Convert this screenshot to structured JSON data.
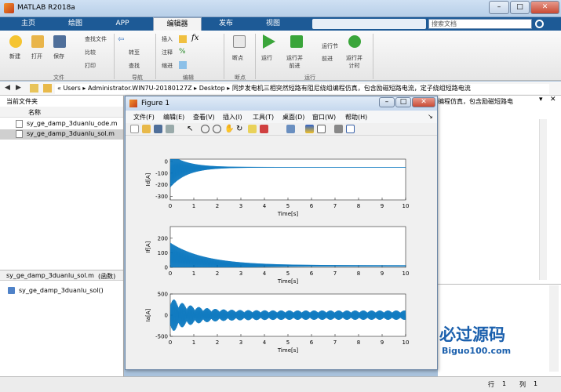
{
  "window": {
    "title": "MATLAB R2018a",
    "search_placeholder": "搜索文档"
  },
  "tabs": [
    "主页",
    "绘图",
    "APP",
    "编辑器",
    "发布",
    "视图"
  ],
  "ribbon": {
    "file": {
      "new": "新建",
      "open": "打开",
      "save": "保存",
      "find_files": "查找文件",
      "compare": "比较",
      "print": "打印",
      "group": "文件"
    },
    "navigate": {
      "goto": "转至",
      "find": "查找",
      "group": "导航"
    },
    "edit": {
      "insert": "插入",
      "comment": "注释",
      "indent": "缩进",
      "fx": "fx",
      "group": "编辑"
    },
    "breakpoints": {
      "label": "断点",
      "group": "断点"
    },
    "run": {
      "run": "运行",
      "run_advance": "运行并\n前进",
      "run_section": "运行节",
      "advance": "前进",
      "run_time": "运行并\n计时",
      "group": "运行"
    }
  },
  "address": {
    "path": [
      "Users",
      "Administrator.WIN7U-20180127Z",
      "Desktop",
      "同步发电机三相突然短路有阻尼绕组编程仿真，包含励磁短路电流，定子绕组短路电流"
    ]
  },
  "left_panel": {
    "title": "当前文件夹",
    "col_name": "名称",
    "files": [
      "sy_ge_damp_3duanlu_ode.m",
      "sy_ge_damp_3duanlu_sol.m"
    ],
    "detail_title": "sy_ge_damp_3duanlu_sol.m",
    "detail_type": "(函数)",
    "detail_item": "sy_ge_damp_3duanlu_sol()"
  },
  "right_panel": {
    "path_tail": "编程仿真，包含励磁短路电"
  },
  "status": {
    "row_label": "行",
    "row": "1",
    "col_label": "列",
    "col": "1"
  },
  "watermark": {
    "cn": "必过源码",
    "en": "Biguo100.com"
  },
  "figure": {
    "title": "Figure 1",
    "menu": [
      "文件(F)",
      "编辑(E)",
      "查看(V)",
      "插入(I)",
      "工具(T)",
      "桌面(D)",
      "窗口(W)",
      "帮助(H)"
    ]
  },
  "chart_data": [
    {
      "type": "line",
      "ylabel": "Id[A]",
      "xlabel": "Time[s]",
      "xlim": [
        0,
        10
      ],
      "ylim": [
        -300,
        0
      ],
      "x_ticks": [
        "0",
        "1",
        "2",
        "3",
        "4",
        "5",
        "6",
        "7",
        "8",
        "9",
        "10"
      ],
      "y_ticks": [
        "0",
        "-100",
        "-200",
        "-300"
      ],
      "series": [
        {
          "values_desc": "decaying oscillation",
          "steady": -50,
          "initial_min": -330,
          "initial_max": 10
        }
      ],
      "color": "#0072bd"
    },
    {
      "type": "line",
      "ylabel": "If[A]",
      "xlabel": "Time[s]",
      "xlim": [
        0,
        10
      ],
      "ylim": [
        0,
        200
      ],
      "x_ticks": [
        "0",
        "1",
        "2",
        "3",
        "4",
        "5",
        "6",
        "7",
        "8",
        "9",
        "10"
      ],
      "y_ticks": [
        "200",
        "100",
        "0"
      ],
      "series": [
        {
          "steady": 10,
          "initial_min": 0,
          "initial_max": 270
        }
      ],
      "color": "#0072bd"
    },
    {
      "type": "line",
      "ylabel": "Ia[A]",
      "xlabel": "Time[s]",
      "xlim": [
        0,
        10
      ],
      "ylim": [
        -500,
        500
      ],
      "x_ticks": [
        "0",
        "1",
        "2",
        "3",
        "4",
        "5",
        "6",
        "7",
        "8",
        "9",
        "10"
      ],
      "y_ticks": [
        "500",
        "0",
        "-500"
      ],
      "series": [
        {
          "steady": 0,
          "initial_amplitude": 420,
          "final_amplitude": 110
        }
      ],
      "color": "#0072bd"
    }
  ]
}
